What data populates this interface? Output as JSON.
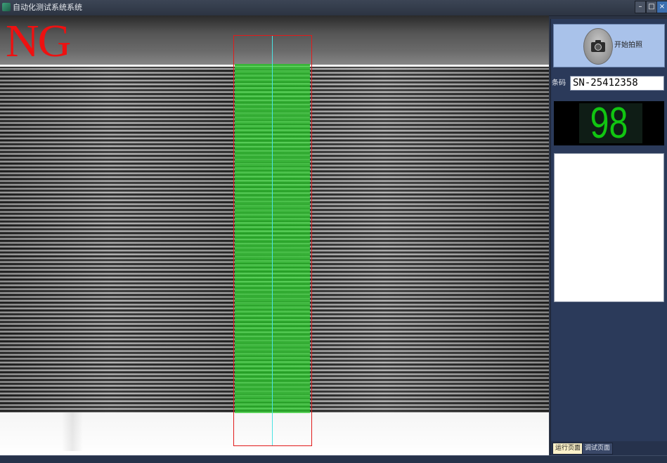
{
  "window": {
    "title": "自动化测试系统系统",
    "controls": {
      "minimize": "–",
      "maximize": "□",
      "close": "×"
    }
  },
  "camera_view": {
    "result_label": "NG",
    "result_color": "#ee1111",
    "roi_color": "#e11b1b",
    "centerline_color": "#49e3e3",
    "detected_band_color": "#32c832"
  },
  "side_panel": {
    "capture_button": {
      "label": "开始拍照",
      "icon": "camera-icon"
    },
    "barcode": {
      "label": "条码",
      "value": "SN-25412358"
    },
    "score": {
      "value": "98",
      "color": "#11c511"
    },
    "tabs": [
      {
        "label": "运行页面",
        "active": true
      },
      {
        "label": "调试页面",
        "active": false
      }
    ]
  }
}
